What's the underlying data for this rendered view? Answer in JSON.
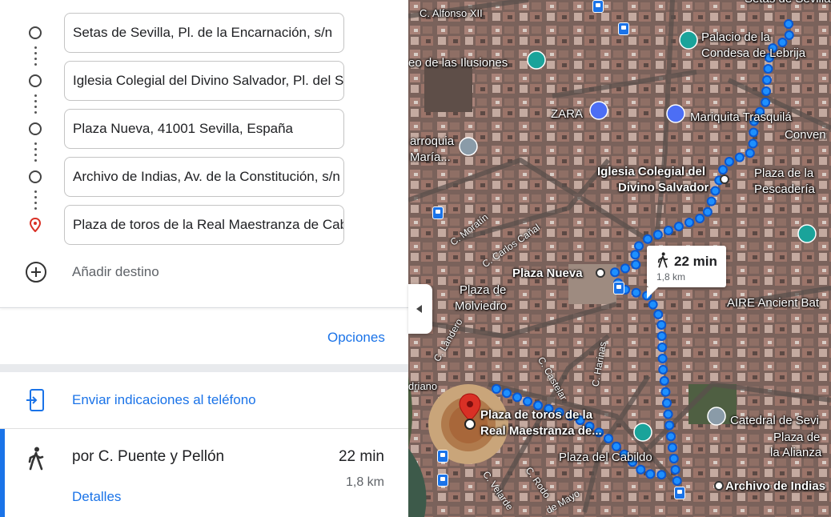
{
  "directions": {
    "stops": [
      {
        "value": "Setas de Sevilla, Pl. de la Encarnación, s/n",
        "type": "waypoint"
      },
      {
        "value": "Iglesia Colegial del Divino Salvador, Pl. del Salvador",
        "type": "waypoint"
      },
      {
        "value": "Plaza Nueva, 41001 Sevilla, España",
        "type": "waypoint"
      },
      {
        "value": "Archivo de Indias, Av. de la Constitución, s/n",
        "type": "waypoint"
      },
      {
        "value": "Plaza de toros de la Real Maestranza de Caballería de Sevilla",
        "type": "destination"
      }
    ],
    "add_destination_label": "Añadir destino",
    "options_label": "Opciones",
    "send_to_phone_label": "Enviar indicaciones al teléfono"
  },
  "route": {
    "via": "por C. Puente y Pellón",
    "duration": "22 min",
    "distance": "1,8 km",
    "details_label": "Detalles"
  },
  "map": {
    "callout": {
      "duration": "22 min",
      "distance": "1,8 km",
      "icon": "walking-icon"
    },
    "labels": {
      "alfonso": "C. Alfonso XII",
      "palacio1": "Palacio de la",
      "palacio2": "Condesa de Lebrija",
      "ilusiones": "eo de las Ilusiones",
      "zara": "ZARA",
      "mariquita1": "Mariquita Trasquilá",
      "conven": "Conven",
      "parroquia1": "arroquia",
      "parroquia2": "María...",
      "iglesia1": "Iglesia Colegial del",
      "iglesia2": "Divino Salvador",
      "pescaderia1": "Plaza de la",
      "pescaderia2": "Pescadería",
      "moratin": "C. Moratín",
      "carlos_canal": "C. Carlos Cañal",
      "plaza_nueva": "Plaza Nueva",
      "molviedro1": "Plaza de",
      "molviedro2": "Molviedro",
      "aire": "AIRE Ancient Bat",
      "landero": "C. Landero",
      "castelar": "C. Castelar",
      "harinas": "C. Harinas",
      "triano": "driano",
      "toros1": "Plaza de toros de la",
      "toros2": "Real Maestranza de...",
      "cabildo": "Plaza del Cabildo",
      "catedral": "Catedral de Sevi",
      "alianza1": "Plaza de",
      "alianza2": "la Alianza",
      "archivo": "Archivo de Indias",
      "velarde": "C. Velarde",
      "rodo": "C. Rodo",
      "mayo": "de Mayo",
      "setas_top": "Setas de Sevilla"
    },
    "accent_color": "#1a73e8",
    "pin_color": "#d93025"
  }
}
